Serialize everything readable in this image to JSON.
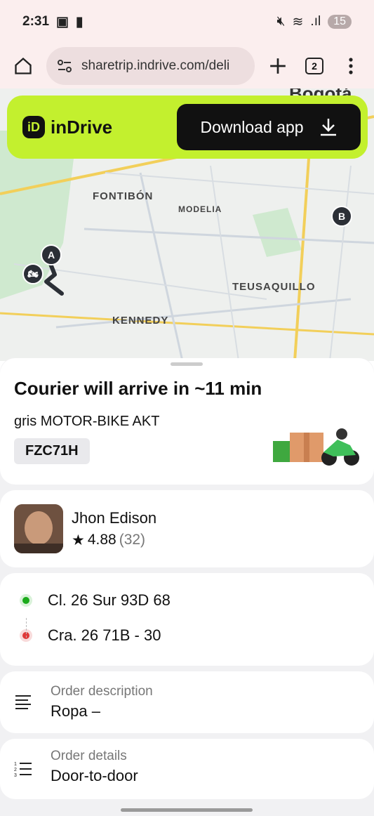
{
  "status_bar": {
    "time": "2:31",
    "battery": "15"
  },
  "browser": {
    "url": "sharetrip.indrive.com/deli",
    "tab_count": "2"
  },
  "banner": {
    "brand": "inDrive",
    "download_label": "Download app"
  },
  "map": {
    "labels": {
      "city": "Bogotá",
      "fontibon": "FONTIBÓN",
      "modelia": "MODELIA",
      "teusaquillo": "TEUSAQUILLO",
      "kennedy": "KENNEDY"
    },
    "marker_a": "A",
    "marker_b": "B"
  },
  "courier": {
    "title": "Courier will arrive in ~11 min",
    "vehicle": "gris MOTOR-BIKE AKT",
    "plate": "FZC71H"
  },
  "driver": {
    "name": "Jhon Edison",
    "rating": "4.88",
    "rating_count": "(32)"
  },
  "route": {
    "from": "Cl. 26 Sur 93D 68",
    "to": "Cra. 26 71B - 30"
  },
  "order_description": {
    "label": "Order description",
    "value": "Ropa –"
  },
  "order_details": {
    "label": "Order details",
    "value": "Door-to-door"
  },
  "colors": {
    "accent": "#c3f02e",
    "from_dot": "#1aaa1a",
    "to_dot": "#e03838"
  }
}
